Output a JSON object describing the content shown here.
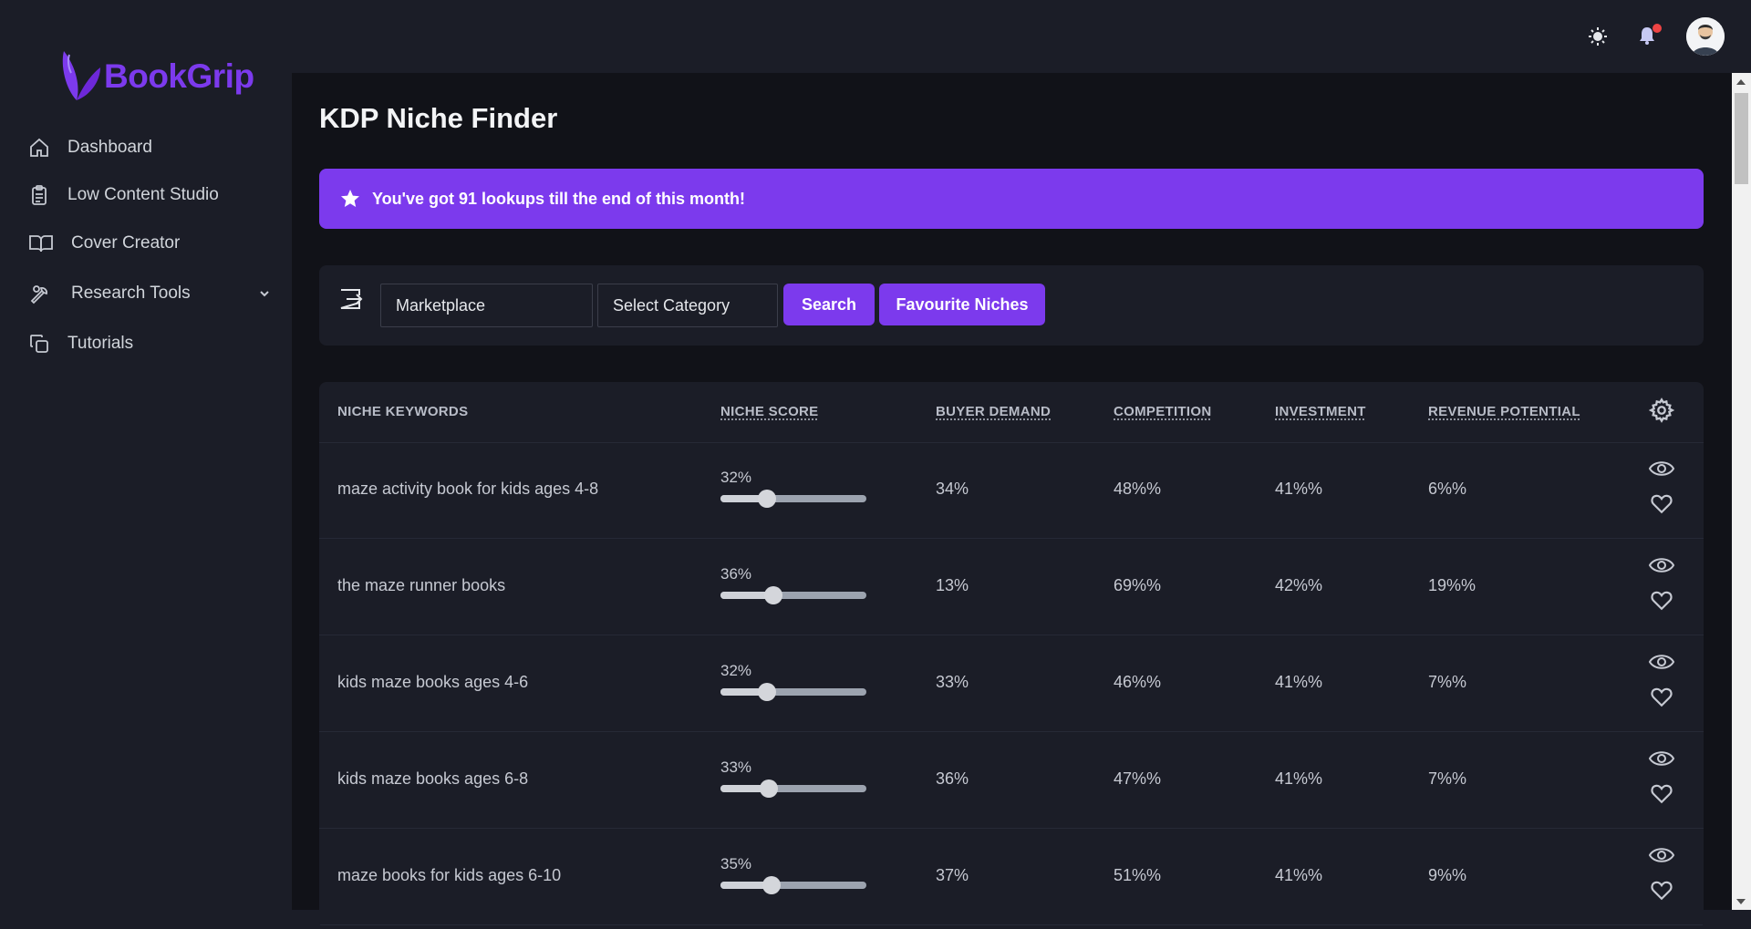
{
  "app": {
    "logo_text": "BookGrip",
    "accent": "#7c3aed"
  },
  "sidebar": {
    "items": [
      {
        "label": "Dashboard",
        "icon": "home-icon"
      },
      {
        "label": "Low Content Studio",
        "icon": "clipboard-icon"
      },
      {
        "label": "Cover Creator",
        "icon": "book-open-icon"
      },
      {
        "label": "Research Tools",
        "icon": "wrench-icon"
      },
      {
        "label": "Tutorials",
        "icon": "copy-icon"
      }
    ]
  },
  "header": {
    "theme_icon": "sun-icon",
    "notif_icon": "bell-icon",
    "avatar": "user-avatar"
  },
  "main": {
    "title": "KDP Niche Finder",
    "banner": "You've got 91 lookups till the end of this month!",
    "search": {
      "marketplace": "Marketplace",
      "category": "Select Category",
      "search_label": "Search",
      "favourites_label": "Favourite Niches"
    },
    "table": {
      "headers": [
        "NICHE KEYWORDS",
        "NICHE SCORE",
        "BUYER DEMAND",
        "COMPETITION",
        "INVESTMENT",
        "REVENUE POTENTIAL"
      ],
      "rows": [
        {
          "keyword": "maze activity book for kids ages 4-8",
          "score_label": "32%",
          "score": 32,
          "demand": "34%",
          "competition": "48%%",
          "investment": "41%%",
          "revenue": "6%%"
        },
        {
          "keyword": "the maze runner books",
          "score_label": "36%",
          "score": 36,
          "demand": "13%",
          "competition": "69%%",
          "investment": "42%%",
          "revenue": "19%%"
        },
        {
          "keyword": "kids maze books ages 4-6",
          "score_label": "32%",
          "score": 32,
          "demand": "33%",
          "competition": "46%%",
          "investment": "41%%",
          "revenue": "7%%"
        },
        {
          "keyword": "kids maze books ages 6-8",
          "score_label": "33%",
          "score": 33,
          "demand": "36%",
          "competition": "47%%",
          "investment": "41%%",
          "revenue": "7%%"
        },
        {
          "keyword": "maze books for kids ages 6-10",
          "score_label": "35%",
          "score": 35,
          "demand": "37%",
          "competition": "51%%",
          "investment": "41%%",
          "revenue": "9%%"
        }
      ]
    }
  }
}
